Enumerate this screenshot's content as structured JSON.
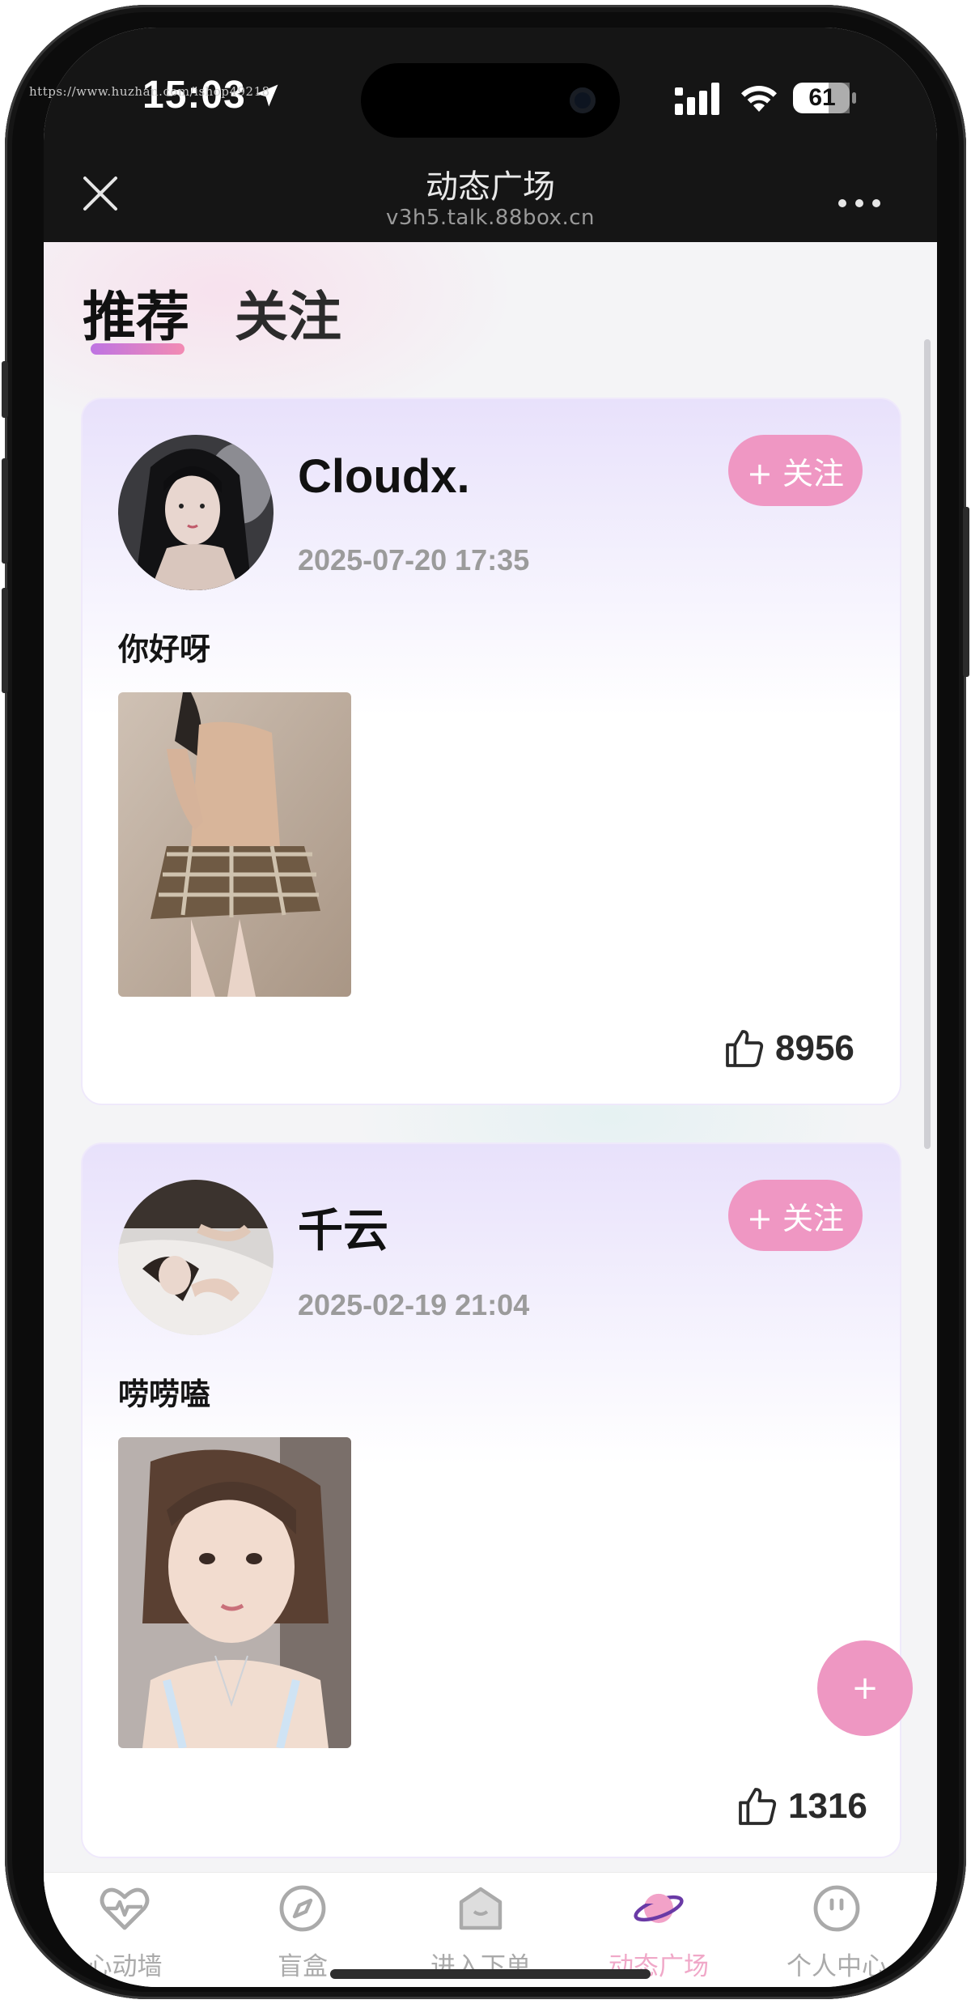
{
  "status_bar": {
    "watermark": "https://www.huzhan.com/ishop49218",
    "time": "15:03",
    "battery": "61",
    "icons": [
      "location-arrow-icon",
      "cellular-signal-icon",
      "wifi-icon",
      "battery-icon"
    ]
  },
  "nav": {
    "title": "动态广场",
    "subtitle": "v3h5.talk.88box.cn",
    "icons": [
      "close-icon",
      "more-icon"
    ]
  },
  "tabs": [
    {
      "label": "推荐",
      "active": true
    },
    {
      "label": "关注",
      "active": false
    }
  ],
  "posts": [
    {
      "username": "Cloudx.",
      "time": "2025-07-20 17:35",
      "follow_label": "+ 关注",
      "text": "你好呀",
      "likes": "8956"
    },
    {
      "username": "千云",
      "time": "2025-02-19 21:04",
      "follow_label": "+ 关注",
      "text": "唠唠嗑",
      "likes": "1316"
    }
  ],
  "fab": {
    "label": "+"
  },
  "tabbar": [
    {
      "label": "心动墙",
      "icon": "heart-pulse-icon",
      "active": false
    },
    {
      "label": "盲盒",
      "icon": "compass-icon",
      "active": false
    },
    {
      "label": "进入下单",
      "icon": "box-icon",
      "active": false
    },
    {
      "label": "动态广场",
      "icon": "planet-icon",
      "active": true
    },
    {
      "label": "个人中心",
      "icon": "face-icon",
      "active": false
    }
  ],
  "colors": {
    "accent_pink": "#ef97c3",
    "active_tab_text": "#f0a8c8",
    "card_gradient_top": "#e8e1fb",
    "dark_bar": "#151515"
  }
}
